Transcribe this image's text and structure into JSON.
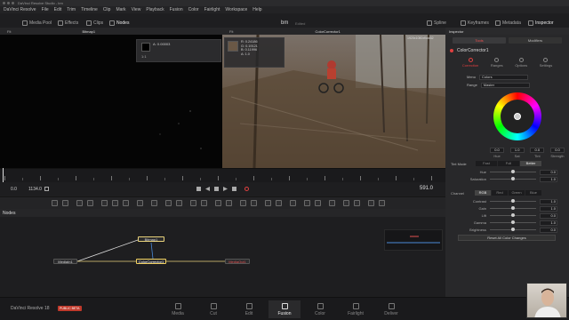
{
  "titlebar": {
    "title": "DaVinci Resolve Studio - bm"
  },
  "menu": [
    "DaVinci Resolve",
    "File",
    "Edit",
    "Trim",
    "Timeline",
    "Clip",
    "Mark",
    "View",
    "Playback",
    "Fusion",
    "Color",
    "Fairlight",
    "Workspace",
    "Help"
  ],
  "toolbar": {
    "media_pool": "Media Pool",
    "effects": "Effects",
    "clips": "Clips",
    "nodes": "Nodes",
    "project_name": "bm",
    "edited": "Edited",
    "spline": "Spline",
    "keyframes": "Keyframes",
    "metadata": "Metadata",
    "inspector": "Inspector"
  },
  "left_viewer": {
    "header_fit": "Fit",
    "title": "Bitmap1",
    "info_value": "A: 0.00003",
    "info_scale": "1:1",
    "resolution": "1920x1080xfloat32"
  },
  "right_viewer": {
    "header_fit": "Fit",
    "title": "ColorCorrector1",
    "resolution": "1920x1080xfloat32",
    "readout": [
      "R: 0.24186",
      "G: 0.19121",
      "B: 0.11996",
      "A: 1.0"
    ]
  },
  "inspector": {
    "header": "Inspector",
    "tab_tools": "Tools",
    "tab_modifiers": "Modifiers",
    "node_name": "ColorCorrector1",
    "subtabs": [
      "Correction",
      "Ranges",
      "Options",
      "Settings"
    ],
    "menu_label": "Menu",
    "menu_value": "Colors",
    "range_label": "Range",
    "range_value": "Master",
    "hsl_values": [
      "0.0",
      "1.0",
      "0.0",
      "0.0"
    ],
    "hsl_labels": [
      "Hue",
      "Sat",
      "Tint",
      "Strength"
    ],
    "tint_mode_label": "Tint Mode",
    "tint_modes": [
      "Fast",
      "Full",
      "Better"
    ],
    "tint_mode_selected": "Better",
    "hue_label": "Hue",
    "hue_value": "0.0",
    "saturation_label": "Saturation",
    "saturation_value": "1.0",
    "channel_label": "Channel",
    "channels": [
      "RGB",
      "Red",
      "Green",
      "Blue"
    ],
    "channel_selected": "RGB",
    "sliders": [
      {
        "label": "Contrast",
        "value": "1.0",
        "pos": 0.5
      },
      {
        "label": "Gain",
        "value": "1.0",
        "pos": 0.5
      },
      {
        "label": "Lift",
        "value": "0.0",
        "pos": 0.5
      },
      {
        "label": "Gamma",
        "value": "1.0",
        "pos": 0.5
      },
      {
        "label": "Brightness",
        "value": "0.0",
        "pos": 0.5
      }
    ],
    "reset_label": "Reset All Color Changes"
  },
  "transport": {
    "start": "0.0",
    "end": "1134.0",
    "current_frame": "591.0"
  },
  "nodes": {
    "header": "Nodes",
    "node_bitmap": "Bitmap1",
    "node_media_in": "MediaIn1",
    "node_color": "ColorCorrector1",
    "node_media_out": "MediaOut1"
  },
  "pages": [
    "Media",
    "Cut",
    "Edit",
    "Fusion",
    "Color",
    "Fairlight",
    "Deliver"
  ],
  "active_page": "Fusion",
  "app_version": "DaVinci Resolve 18",
  "beta_badge": "PUBLIC BETA",
  "colors": {
    "accent": "#e04040",
    "node_link": "#e8d27a",
    "selected_node": "#f0d060"
  }
}
